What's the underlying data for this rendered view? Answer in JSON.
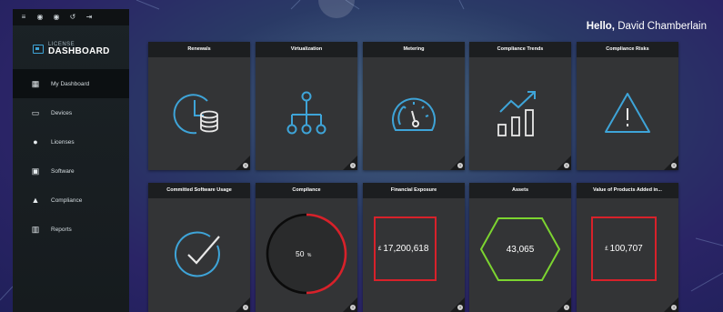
{
  "topbar": {
    "icons": [
      "menu-icon",
      "settings-icon",
      "refresh-icon",
      "undo-icon",
      "logout-icon"
    ],
    "glyphs": [
      "≡",
      "◉",
      "◉",
      "↺",
      "⇥"
    ]
  },
  "logo": {
    "small": "LICENSE",
    "big": "DASHBOARD"
  },
  "sidebar": {
    "items": [
      {
        "label": "My Dashboard",
        "icon": "grid-icon",
        "glyph": "▦",
        "active": true
      },
      {
        "label": "Devices",
        "icon": "laptop-icon",
        "glyph": "▭",
        "active": false
      },
      {
        "label": "Licenses",
        "icon": "license-icon",
        "glyph": "●",
        "active": false
      },
      {
        "label": "Software",
        "icon": "software-icon",
        "glyph": "▣",
        "active": false
      },
      {
        "label": "Compliance",
        "icon": "warning-icon",
        "glyph": "▲",
        "active": false
      },
      {
        "label": "Reports",
        "icon": "chart-icon",
        "glyph": "▥",
        "active": false
      }
    ]
  },
  "header": {
    "hello": "Hello,",
    "user": "David Chamberlain"
  },
  "tiles_row1": [
    {
      "title": "Renewals",
      "icon": "clock-coins-icon"
    },
    {
      "title": "Virtualization",
      "icon": "hierarchy-icon"
    },
    {
      "title": "Metering",
      "icon": "gauge-icon"
    },
    {
      "title": "Compliance Trends",
      "icon": "trend-chart-icon"
    },
    {
      "title": "Compliance Risks",
      "icon": "warning-triangle-icon"
    }
  ],
  "tiles_row2": [
    {
      "title": "Committed Software Usage",
      "icon": "checkmark-circle-icon"
    },
    {
      "title": "Compliance",
      "value": "50",
      "unit": "%"
    },
    {
      "title": "Financial Exposure",
      "currency": "£",
      "value": "17,200,618"
    },
    {
      "title": "Assets",
      "value": "43,065"
    },
    {
      "title": "Value of Products Added in...",
      "currency": "£",
      "value": "100,707"
    }
  ],
  "compliance_percent": 50,
  "colors": {
    "accent_blue": "#3ea4d8",
    "red": "#d8212a",
    "green": "#7cd430",
    "tile_bg": "#333436",
    "tile_header": "#1c1e20",
    "sidebar_bg": "#1b2226"
  },
  "info_glyph": "i"
}
